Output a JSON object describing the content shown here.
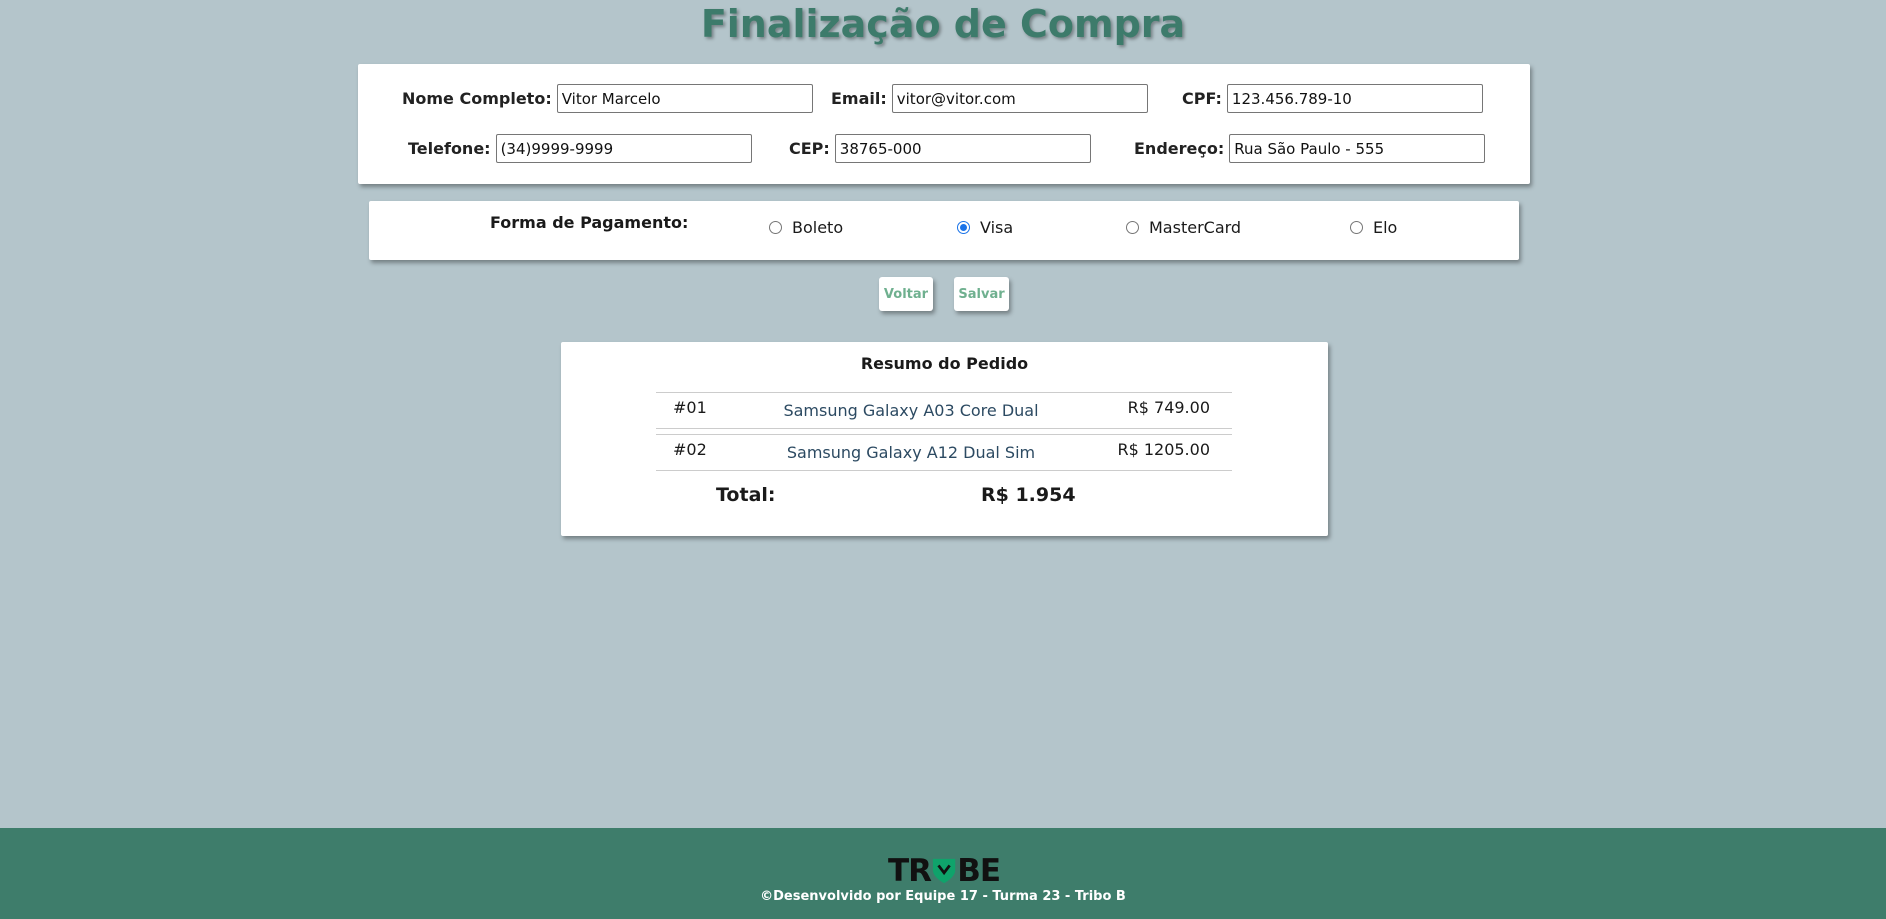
{
  "page": {
    "title": "Finalização de Compra"
  },
  "form": {
    "fields": [
      {
        "label": "Nome Completo:",
        "value": "Vitor Marcelo"
      },
      {
        "label": "Email:",
        "value": "vitor@vitor.com"
      },
      {
        "label": "CPF:",
        "value": "123.456.789-10"
      },
      {
        "label": "Telefone:",
        "value": "(34)9999-9999"
      },
      {
        "label": "CEP:",
        "value": "38765-000"
      },
      {
        "label": "Endereço:",
        "value": "Rua São Paulo - 555"
      }
    ]
  },
  "payment": {
    "label": "Forma de Pagamento:",
    "options": [
      "Boleto",
      "Visa",
      "MasterCard",
      "Elo"
    ],
    "selected": "Visa"
  },
  "buttons": {
    "back": "Voltar",
    "save": "Salvar"
  },
  "summary": {
    "title": "Resumo do Pedido",
    "items": [
      {
        "num": "#01",
        "name": "Samsung Galaxy A03 Core Dual",
        "price": "R$ 749.00"
      },
      {
        "num": "#02",
        "name": "Samsung Galaxy A12 Dual Sim",
        "price": "R$ 1205.00"
      }
    ],
    "total_label": "Total:",
    "total_value": "R$ 1.954"
  },
  "footer": {
    "logo_text": "TRYBE",
    "text": "©Desenvolvido por Equipe 17 - Turma 23 - Tribo B"
  },
  "colors": {
    "accent": "#3d7b6b",
    "background": "#b4c5cb",
    "button_text": "#6fb08f"
  }
}
